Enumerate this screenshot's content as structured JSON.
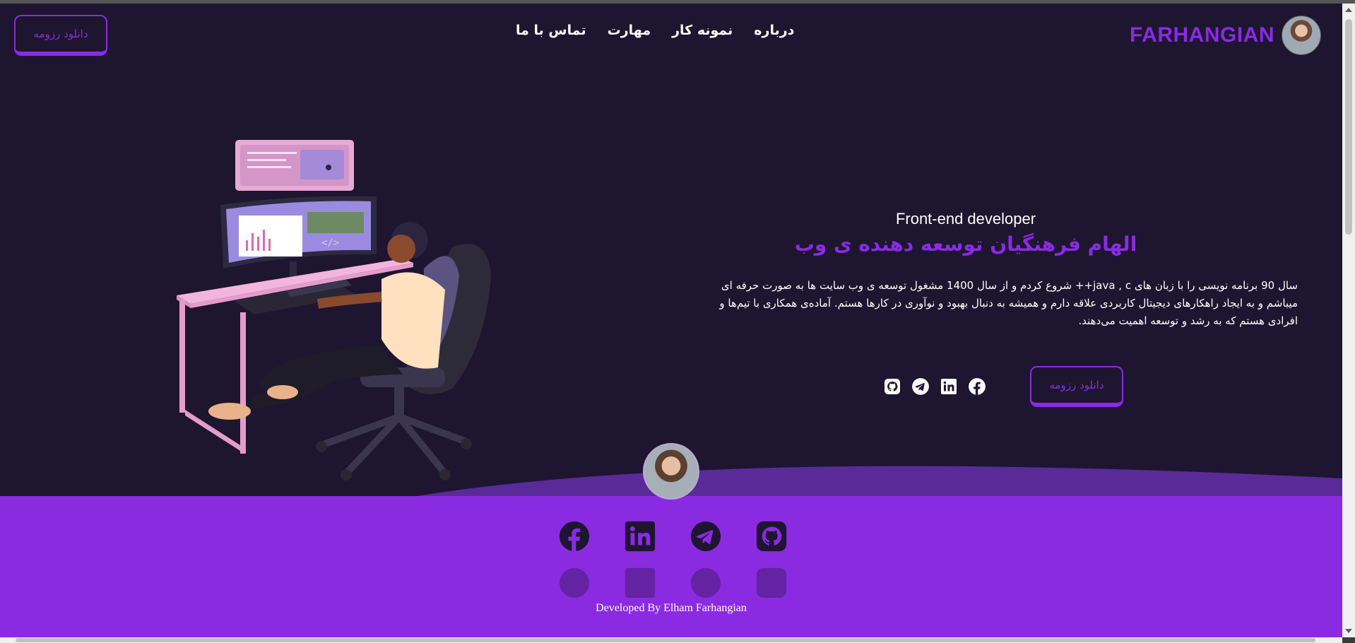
{
  "header": {
    "resume_button": "دانلود رزومه",
    "nav": [
      "درباره",
      "نمونه کار",
      "مهارت",
      "تماس با ما"
    ],
    "brand": "FARHANGIAN"
  },
  "hero": {
    "role": "Front-end developer",
    "headline": "الهام فرهنگیان توسعه دهنده ی وب",
    "bio": "سال 90 برنامه نویسی را با زبان های java , c++ شروع کردم و از سال 1400 مشغول توسعه ی وب سایت ها به صورت حرفه ای میباشم و به ایجاد راهکارهای دیجیتال کاربردی علاقه دارم و همیشه به دنبال بهبود و نوآوری در کارها هستم. آماده‌ی همکاری با تیم‌ها و افرادی هستم که به رشد و توسعه اهمیت می‌دهند.",
    "resume_button": "دانلود رزومه",
    "socials": [
      "github-icon",
      "telegram-icon",
      "linkedin-icon",
      "facebook-icon"
    ]
  },
  "footer": {
    "socials": [
      "facebook-icon",
      "linkedin-icon",
      "telegram-icon",
      "github-icon"
    ],
    "credit": "Developed By Elham Farhangian"
  },
  "colors": {
    "background": "#1e1530",
    "accent": "#8a2be2",
    "text": "#ffffff"
  }
}
